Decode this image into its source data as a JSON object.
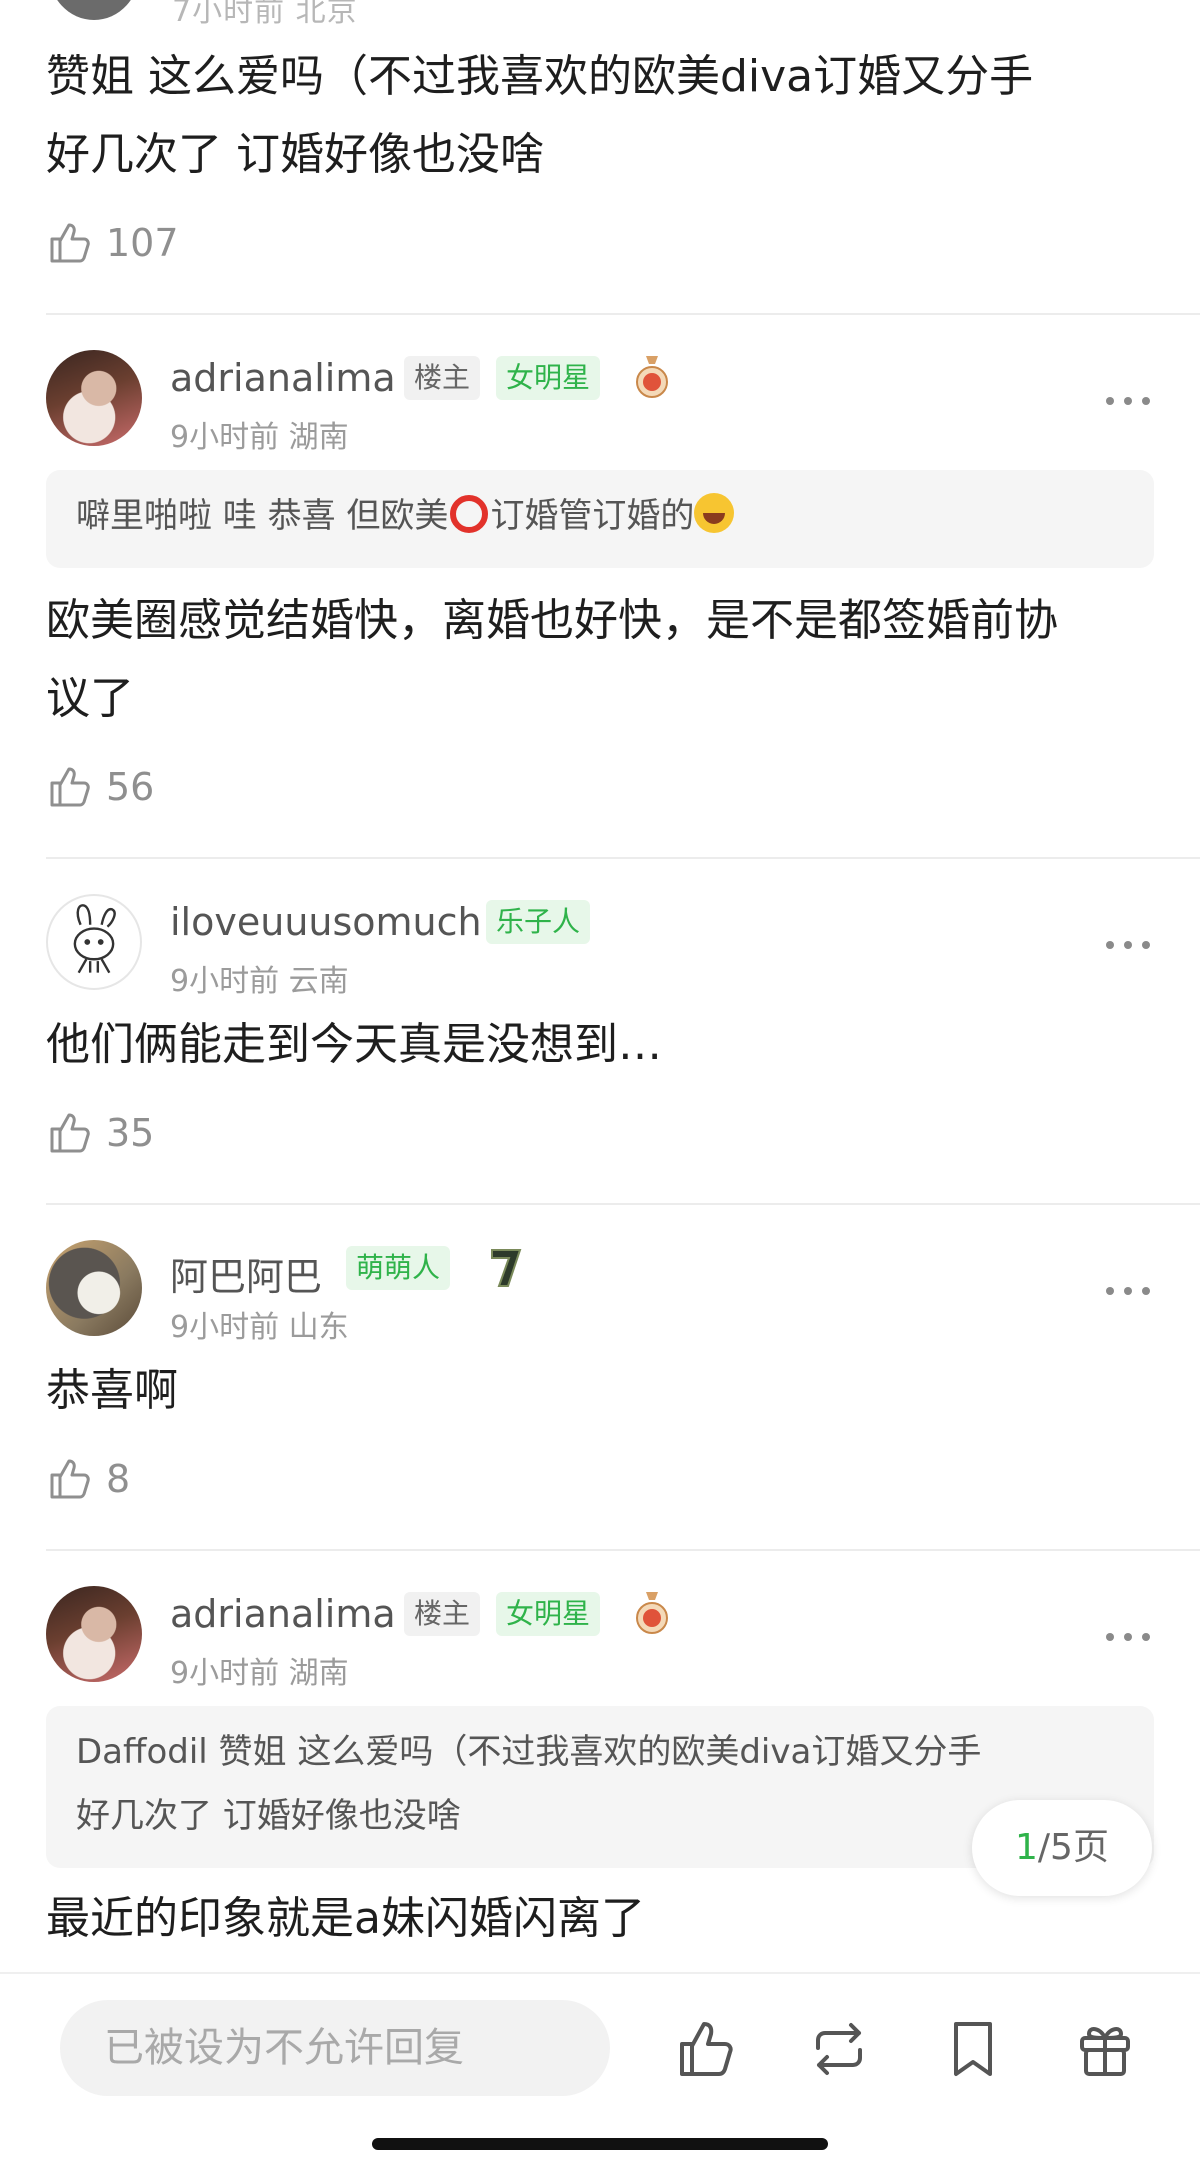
{
  "top_comment": {
    "meta": "7小时前 北京",
    "text_line1": "赞姐 这么爱吗（不过我喜欢的欧美diva订婚又分手",
    "text_line2": "好几次了  订婚好像也没啥",
    "likes": "107"
  },
  "comments": [
    {
      "username": "adrianalima",
      "owner_badge": "楼主",
      "tag": "女明星",
      "meta": "9小时前 湖南",
      "quote_prefix": "噼里啪啦 哇 恭喜 但欧美",
      "quote_suffix": "订婚管订婚的",
      "text_line1": "欧美圈感觉结婚快，离婚也好快，是不是都签婚前协",
      "text_line2": "议了",
      "likes": "56"
    },
    {
      "username": "iloveuuusomuch",
      "tag": "乐子人",
      "meta": "9小时前 云南",
      "text": "他们俩能走到今天真是没想到…",
      "likes": "35"
    },
    {
      "username": "阿巴阿巴",
      "tag": "萌萌人",
      "meta": "9小时前 山东",
      "text": "恭喜啊",
      "likes": "8"
    },
    {
      "username": "adrianalima",
      "owner_badge": "楼主",
      "tag": "女明星",
      "meta": "9小时前 湖南",
      "quote_line1": "Daffodil 赞姐 这么爱吗（不过我喜欢的欧美diva订婚又分手",
      "quote_line2": "好几次了  订婚好像也没啥",
      "text": "最近的印象就是a妹闪婚闪离了"
    }
  ],
  "pager": {
    "current": "1",
    "total": "/5页"
  },
  "bottom_bar": {
    "reply_placeholder": "已被设为不允许回复",
    "icons": [
      "like-icon",
      "repost-icon",
      "bookmark-icon",
      "gift-icon"
    ]
  },
  "colors": {
    "accent_green": "#2fb34a",
    "tag_bg": "#e7f7e9",
    "text_grey": "#9b9b9b"
  }
}
